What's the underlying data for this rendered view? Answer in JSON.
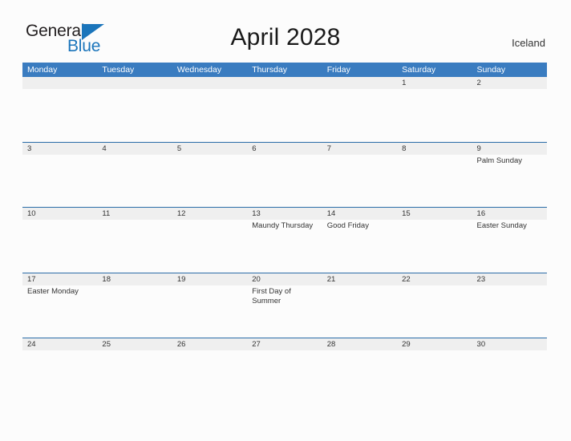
{
  "brand": {
    "name_part1": "General",
    "name_part2": "Blue",
    "flag_icon": "blue-triangle-flag"
  },
  "header": {
    "title": "April 2028",
    "country": "Iceland"
  },
  "calendar": {
    "weekdays": [
      "Monday",
      "Tuesday",
      "Wednesday",
      "Thursday",
      "Friday",
      "Saturday",
      "Sunday"
    ],
    "colors": {
      "header_blue": "#3a7cc0",
      "row_divider_blue": "#2a6ca8",
      "day_band_gray": "#efefef",
      "brand_blue": "#1b75bb",
      "page_background": "#fcfcfc"
    },
    "weeks": [
      {
        "days": [
          {
            "num": "",
            "event": ""
          },
          {
            "num": "",
            "event": ""
          },
          {
            "num": "",
            "event": ""
          },
          {
            "num": "",
            "event": ""
          },
          {
            "num": "",
            "event": ""
          },
          {
            "num": "1",
            "event": ""
          },
          {
            "num": "2",
            "event": ""
          }
        ]
      },
      {
        "days": [
          {
            "num": "3",
            "event": ""
          },
          {
            "num": "4",
            "event": ""
          },
          {
            "num": "5",
            "event": ""
          },
          {
            "num": "6",
            "event": ""
          },
          {
            "num": "7",
            "event": ""
          },
          {
            "num": "8",
            "event": ""
          },
          {
            "num": "9",
            "event": "Palm Sunday"
          }
        ]
      },
      {
        "days": [
          {
            "num": "10",
            "event": ""
          },
          {
            "num": "11",
            "event": ""
          },
          {
            "num": "12",
            "event": ""
          },
          {
            "num": "13",
            "event": "Maundy Thursday"
          },
          {
            "num": "14",
            "event": "Good Friday"
          },
          {
            "num": "15",
            "event": ""
          },
          {
            "num": "16",
            "event": "Easter Sunday"
          }
        ]
      },
      {
        "days": [
          {
            "num": "17",
            "event": "Easter Monday"
          },
          {
            "num": "18",
            "event": ""
          },
          {
            "num": "19",
            "event": ""
          },
          {
            "num": "20",
            "event": "First Day of Summer"
          },
          {
            "num": "21",
            "event": ""
          },
          {
            "num": "22",
            "event": ""
          },
          {
            "num": "23",
            "event": ""
          }
        ]
      },
      {
        "days": [
          {
            "num": "24",
            "event": ""
          },
          {
            "num": "25",
            "event": ""
          },
          {
            "num": "26",
            "event": ""
          },
          {
            "num": "27",
            "event": ""
          },
          {
            "num": "28",
            "event": ""
          },
          {
            "num": "29",
            "event": ""
          },
          {
            "num": "30",
            "event": ""
          }
        ]
      }
    ]
  }
}
